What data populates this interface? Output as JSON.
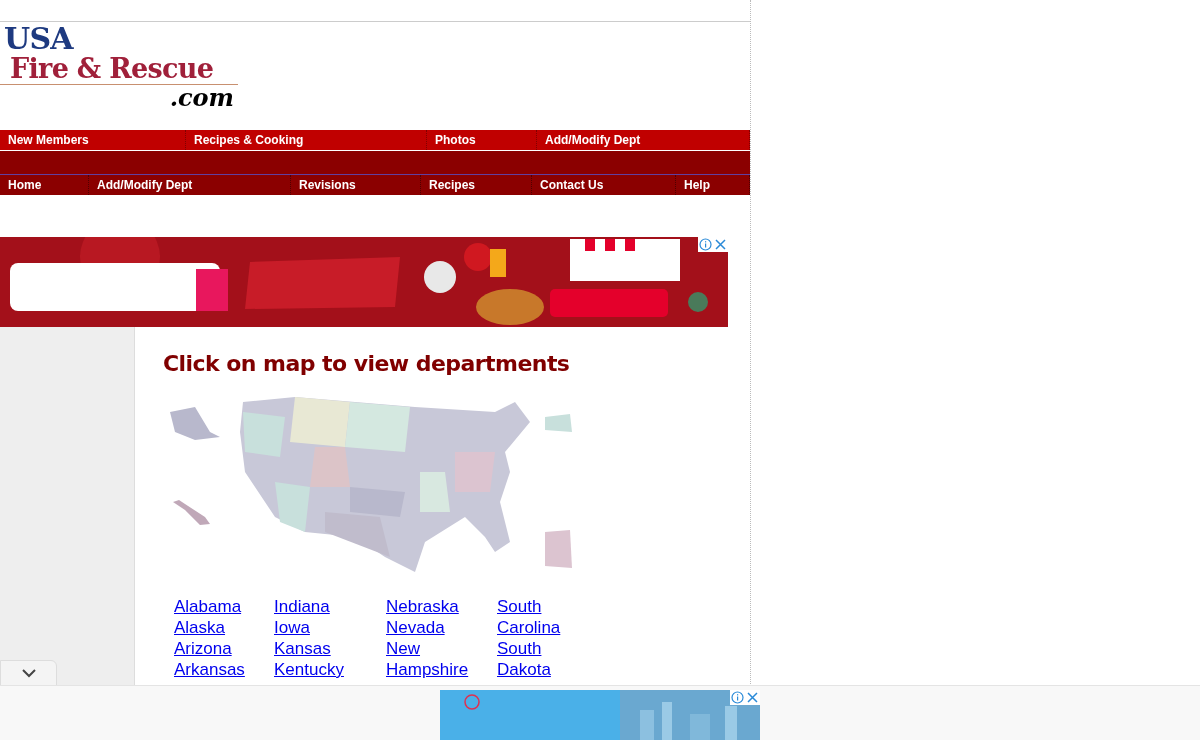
{
  "logo": {
    "line_1": "USA",
    "line_2": "Fire & Rescue",
    "line_3": ".com"
  },
  "nav_primary": [
    "New Members",
    "Recipes & Cooking",
    "Photos",
    "Add/Modify Dept"
  ],
  "nav_secondary": [
    "Home",
    "Add/Modify Dept",
    "Revisions",
    "Recipes",
    "Contact Us",
    "Help"
  ],
  "top_ad": {
    "kind": "picture"
  },
  "main": {
    "heading": "Click on map to view departments",
    "map": {
      "kind": "picture"
    },
    "state_links": [
      [
        "Alabama",
        "Alaska",
        "Arizona",
        "Arkansas"
      ],
      [
        "Indiana",
        "Iowa",
        "Kansas",
        "Kentucky"
      ],
      [
        "Nebraska",
        "Nevada",
        "New",
        "Hampshire"
      ],
      [
        "South",
        "Carolina",
        "South",
        "Dakota"
      ]
    ]
  },
  "bottom_ad": {
    "kind": "picture"
  }
}
